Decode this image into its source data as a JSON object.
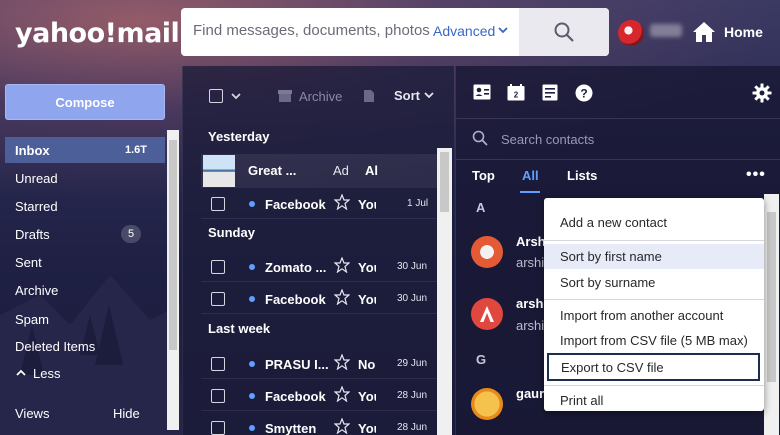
{
  "header": {
    "logo": "yahoo!mail",
    "search_placeholder": "Find messages, documents, photos",
    "advanced_label": "Advanced",
    "home_label": "Home"
  },
  "nav": {
    "compose_label": "Compose",
    "items": [
      {
        "label": "Inbox",
        "count": "1.6T"
      },
      {
        "label": "Unread"
      },
      {
        "label": "Starred"
      },
      {
        "label": "Drafts",
        "badge": "5"
      },
      {
        "label": "Sent"
      },
      {
        "label": "Archive"
      },
      {
        "label": "Spam"
      },
      {
        "label": "Deleted Items"
      },
      {
        "label": "Less"
      }
    ],
    "views_label": "Views",
    "hide_label": "Hide"
  },
  "toolbar": {
    "archive_label": "Archive",
    "sort_label": "Sort"
  },
  "messages": {
    "sections": [
      "Yesterday",
      "Sunday",
      "Last week"
    ],
    "ad": {
      "title": "Great ...",
      "tag": "Ad",
      "more": "Al"
    },
    "rows": [
      {
        "sender": "Facebook",
        "subject": "You",
        "date": "1 Jul"
      },
      {
        "sender": "Zomato ...",
        "subject": "You",
        "date": "30 Jun"
      },
      {
        "sender": "Facebook",
        "subject": "You",
        "date": "30 Jun"
      },
      {
        "sender": "PRASU I...",
        "subject": "No",
        "date": "29 Jun"
      },
      {
        "sender": "Facebook",
        "subject": "You",
        "date": "28 Jun"
      },
      {
        "sender": "Smytten",
        "subject": "You",
        "date": "28 Jun"
      }
    ]
  },
  "contacts": {
    "search_placeholder": "Search contacts",
    "tabs": [
      "Top",
      "All",
      "Lists"
    ],
    "letters": [
      "A",
      "G"
    ],
    "list": [
      {
        "name": "Arsh",
        "sub": "arshi"
      },
      {
        "name": "arshi",
        "sub": "arshi"
      },
      {
        "name": "gaur",
        "sub": ""
      }
    ]
  },
  "menu": {
    "items": [
      "Add a new contact",
      "Sort by first name",
      "Sort by surname",
      "Import from another account",
      "Import from CSV file (5 MB max)",
      "Export to CSV file",
      "Print all"
    ]
  }
}
